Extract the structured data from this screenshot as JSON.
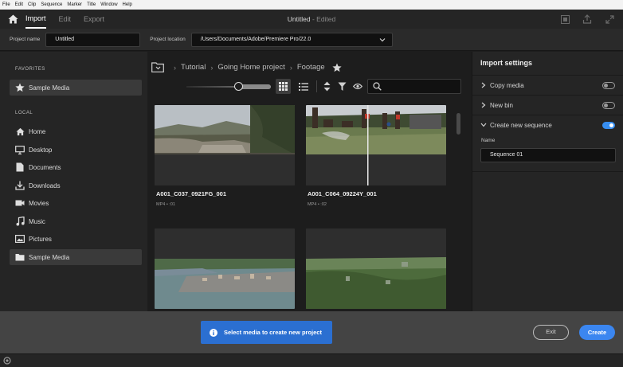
{
  "os_menu": [
    "File",
    "Edit",
    "Clip",
    "Sequence",
    "Marker",
    "Title",
    "Window",
    "Help"
  ],
  "header": {
    "home_icon": "home-icon",
    "tabs": [
      {
        "label": "Import",
        "active": true
      },
      {
        "label": "Edit",
        "active": false
      },
      {
        "label": "Export",
        "active": false
      }
    ],
    "doc_title": "Untitled",
    "doc_state": "- Edited",
    "right_icons": [
      "quick-export-icon",
      "share-icon",
      "fullscreen-icon"
    ]
  },
  "project": {
    "name_label": "Project name",
    "name_value": "Untitled",
    "location_label": "Project location",
    "location_value": "/Users/Documents/Adobe/Premiere Pro/22.0"
  },
  "sidebar": {
    "favorites_heading": "FAVORITES",
    "favorites": [
      {
        "label": "Sample Media",
        "icon": "star-icon",
        "selected": true
      }
    ],
    "local_heading": "LOCAL",
    "local": [
      {
        "label": "Home",
        "icon": "home-icon"
      },
      {
        "label": "Desktop",
        "icon": "desktop-icon"
      },
      {
        "label": "Documents",
        "icon": "document-icon"
      },
      {
        "label": "Downloads",
        "icon": "download-icon"
      },
      {
        "label": "Movies",
        "icon": "movie-icon"
      },
      {
        "label": "Music",
        "icon": "music-icon"
      },
      {
        "label": "Pictures",
        "icon": "picture-icon"
      },
      {
        "label": "Sample Media",
        "icon": "folder-icon",
        "selected": true
      }
    ]
  },
  "breadcrumb": [
    "Tutorial",
    "Going Home project",
    "Footage"
  ],
  "media": [
    {
      "name": "A001_C037_0921FG_001",
      "meta": "MP4 • :01"
    },
    {
      "name": "A001_C064_09224Y_001",
      "meta": "MP4 • :02"
    },
    {
      "name": "",
      "meta": ""
    },
    {
      "name": "",
      "meta": ""
    }
  ],
  "import_settings": {
    "title": "Import settings",
    "rows": [
      {
        "label": "Copy media",
        "on": false,
        "expanded": false
      },
      {
        "label": "New bin",
        "on": false,
        "expanded": false
      },
      {
        "label": "Create new sequence",
        "on": true,
        "expanded": true
      }
    ],
    "seq_name_label": "Name",
    "seq_name_value": "Sequence 01"
  },
  "bottom": {
    "toast": "Select media to create new project",
    "exit_label": "Exit",
    "create_label": "Create"
  },
  "colors": {
    "accent": "#378ef0",
    "toast": "#2b6fd1",
    "bottom_bar": "#444444"
  }
}
